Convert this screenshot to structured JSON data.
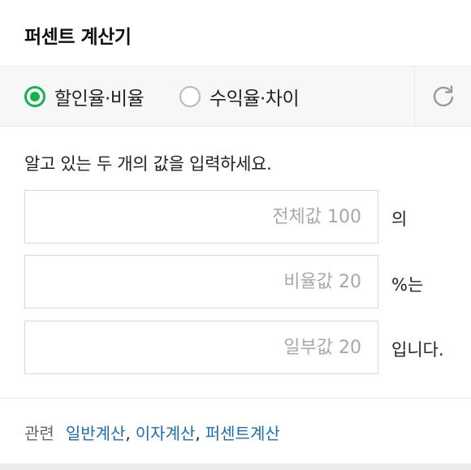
{
  "title": "퍼센트 계산기",
  "modes": [
    {
      "label": "할인율·비율",
      "selected": true
    },
    {
      "label": "수익율·차이",
      "selected": false
    }
  ],
  "refresh_icon": "refresh-icon",
  "instruction": "알고 있는 두 개의 값을 입력하세요.",
  "inputs": [
    {
      "placeholder": "전체값 100",
      "value": "",
      "suffix": "의"
    },
    {
      "placeholder": "비율값 20",
      "value": "",
      "suffix": "%는"
    },
    {
      "placeholder": "일부값 20",
      "value": "",
      "suffix": "입니다."
    }
  ],
  "related": {
    "label": "관련",
    "links": [
      "일반계산",
      "이자계산",
      "퍼센트계산"
    ],
    "separator": ","
  },
  "colors": {
    "accent_green": "#11b54a",
    "link_blue": "#1b6fb0"
  }
}
